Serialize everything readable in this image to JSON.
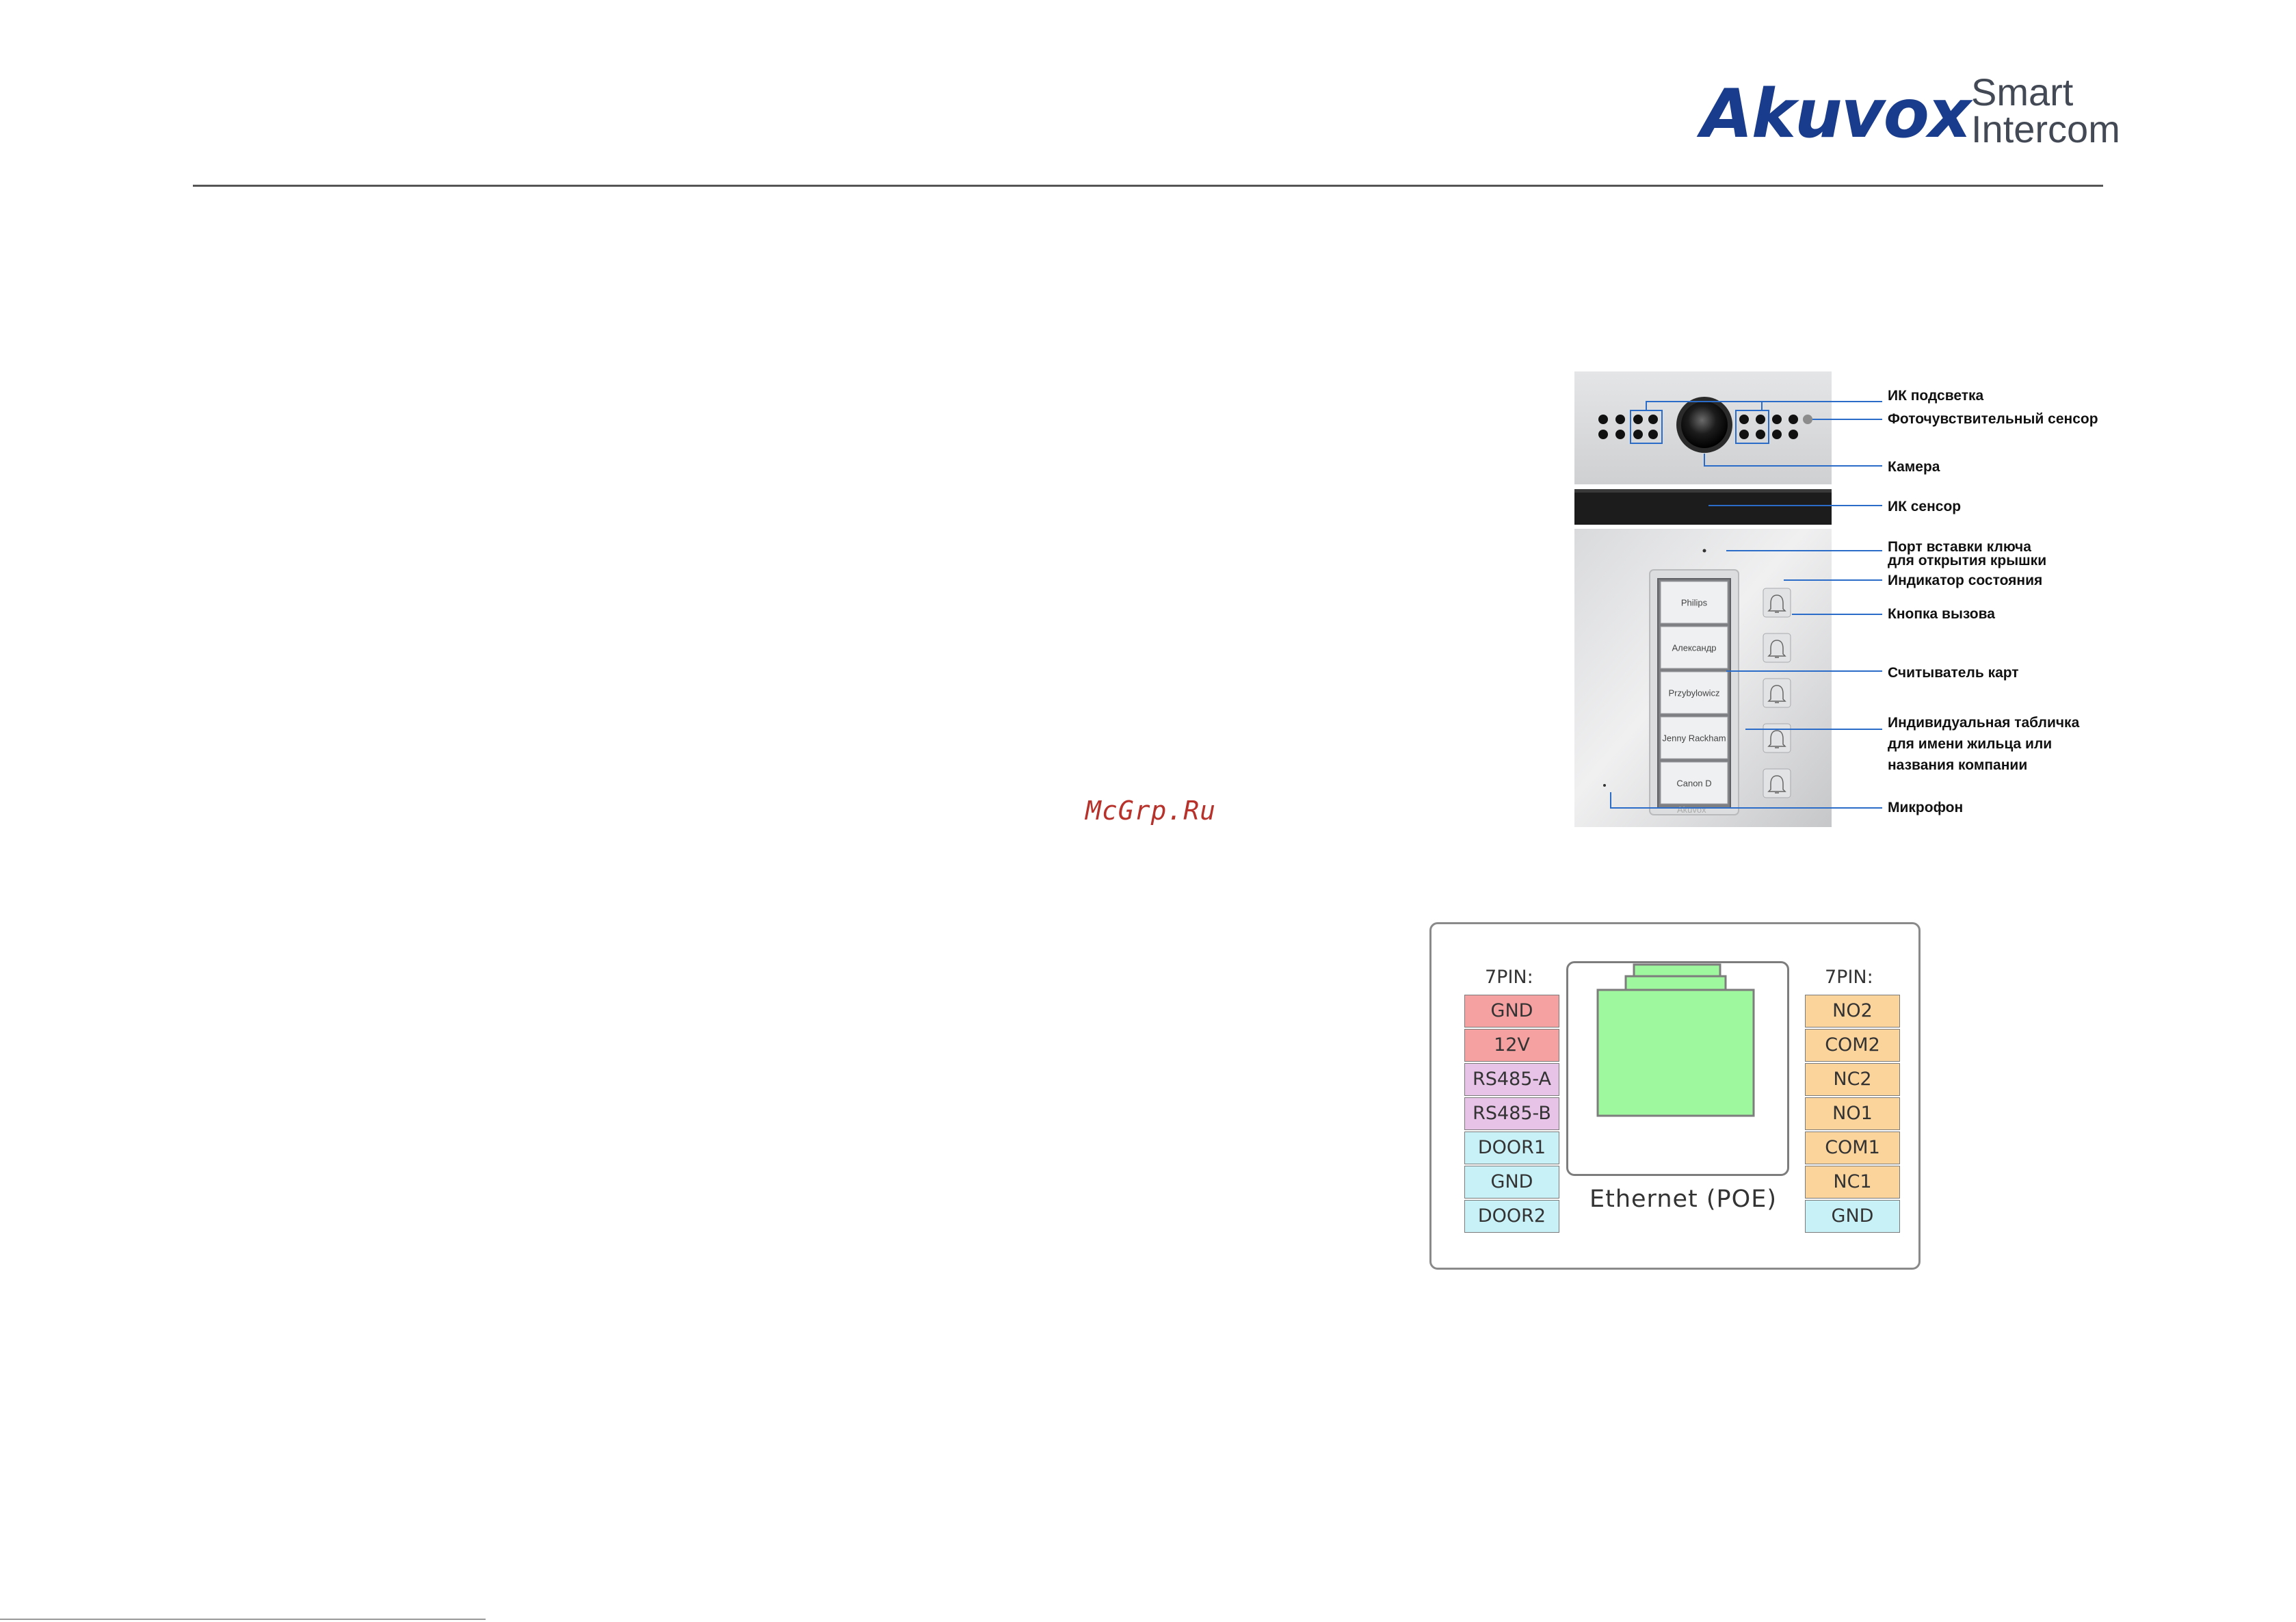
{
  "header": {
    "brand": "Akuvox",
    "brand_sub_line1": "Smart",
    "brand_sub_line2": "Intercom"
  },
  "watermark": "McGrp.Ru",
  "device": {
    "name_plates": [
      "Philips",
      "Александр",
      "Przybylowicz",
      "Jenny Rackham",
      "Canon D"
    ],
    "callouts": [
      "ИК подсветка",
      "Фоточувствительный сенсор",
      "Камера",
      "ИК сенсор",
      "Порт вставки ключа",
      "для открытия крышки",
      "Индикатор состояния",
      "Кнопка вызова",
      "Считыватель карт",
      "Индивидуальная табличка",
      "для имени жильца или",
      "названия компании",
      "Микрофон"
    ]
  },
  "wiring": {
    "left_title": "7PIN:",
    "right_title": "7PIN:",
    "left_pins": [
      "GND",
      "12V",
      "RS485-A",
      "RS485-B",
      "DOOR1",
      "GND",
      "DOOR2"
    ],
    "right_pins": [
      "NO2",
      "COM2",
      "NC2",
      "NO1",
      "COM1",
      "NC1",
      "GND"
    ],
    "ethernet_label": "Ethernet (POE)",
    "colors": {
      "power": "#f6a1a1",
      "rs485": "#e7c4e7",
      "door": "#c7f0f7",
      "relay": "#fbd49c",
      "ethernet_port": "#9ef89e"
    }
  }
}
